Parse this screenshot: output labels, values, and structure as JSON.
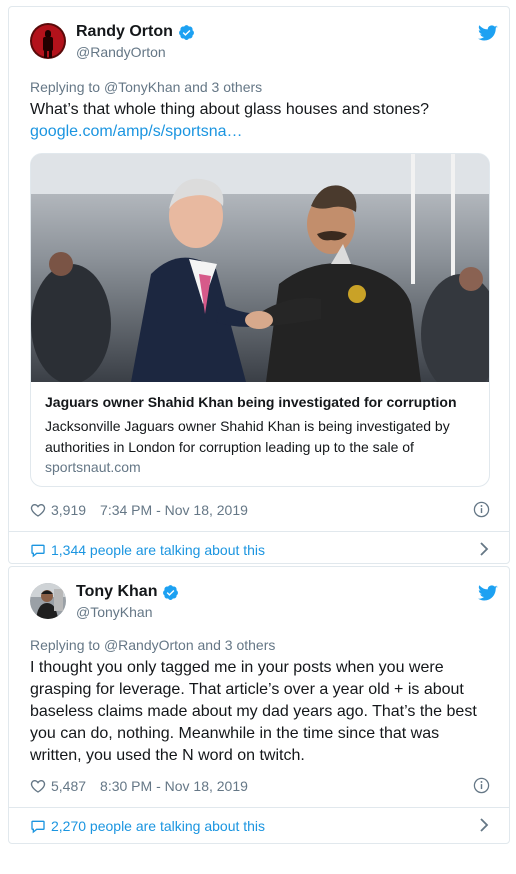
{
  "tweets": [
    {
      "display_name": "Randy Orton",
      "handle": "@RandyOrton",
      "reply_prefix": "Replying to",
      "reply_to": "@TonyKhan and 3 others",
      "text": "What’s that whole thing about glass houses and stones?",
      "link": "google.com/amp/s/sportsna…",
      "card": {
        "title": "Jaguars owner Shahid Khan being investigated for corruption",
        "description": "Jacksonville Jaguars owner Shahid Khan is being investigated by authorities in London for corruption leading up to the sale of",
        "domain": "sportsnaut.com"
      },
      "likes": "3,919",
      "time": "7:34 PM - Nov 18, 2019",
      "talking": "1,344 people are talking about this"
    },
    {
      "display_name": "Tony Khan",
      "handle": "@TonyKhan",
      "reply_prefix": "Replying to",
      "reply_to": "@RandyOrton and 3 others",
      "text": "I thought you only tagged me in your posts when you were grasping for leverage. That article’s over a year old + is about baseless claims made about my dad years ago. That’s the best you can do, nothing. Meanwhile in the time since that was written, you used the N word on twitch.",
      "likes": "5,487",
      "time": "8:30 PM - Nov 18, 2019",
      "talking": "2,270 people are talking about this"
    }
  ],
  "colors": {
    "twitter_blue": "#1da1f2",
    "link_blue": "#1b95e0",
    "secondary_text": "#657786",
    "border": "#e1e8ed"
  },
  "icons": [
    "verified-badge-icon",
    "twitter-bird-icon",
    "heart-icon",
    "info-icon",
    "speech-bubble-icon",
    "chevron-right-icon"
  ]
}
